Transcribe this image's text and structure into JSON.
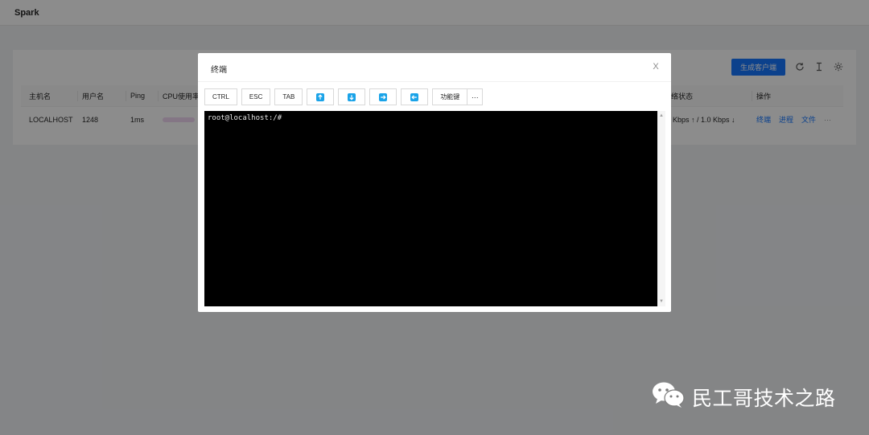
{
  "app": {
    "title": "Spark"
  },
  "card": {
    "generate_button": "生成客户端",
    "icons": [
      "refresh-icon",
      "text-cursor-icon",
      "settings-icon"
    ]
  },
  "table": {
    "columns": [
      "主机名",
      "用户名",
      "Ping",
      "CPU使用率",
      "络状态",
      "操作"
    ],
    "row": {
      "hostname": "LOCALHOST",
      "username": "1248",
      "ping": "1ms",
      "network": "Kbps ↑ / 1.0 Kbps ↓",
      "actions": [
        "终端",
        "进程",
        "文件",
        "···"
      ]
    }
  },
  "modal": {
    "title": "终端",
    "close": "X",
    "toolbar": {
      "ctrl": "CTRL",
      "esc": "ESC",
      "tab": "TAB",
      "arrows": [
        "arrow-up-icon",
        "arrow-down-icon",
        "arrow-right-icon",
        "arrow-left-icon"
      ],
      "function_keys": "功能键",
      "more": "···"
    },
    "terminal": {
      "prompt": "root@localhost:/#"
    }
  },
  "watermark": {
    "text": "民工哥技术之路"
  },
  "colors": {
    "primary": "#1677ff",
    "arrow": "#1aa3e8",
    "terminal_bg": "#000000"
  }
}
